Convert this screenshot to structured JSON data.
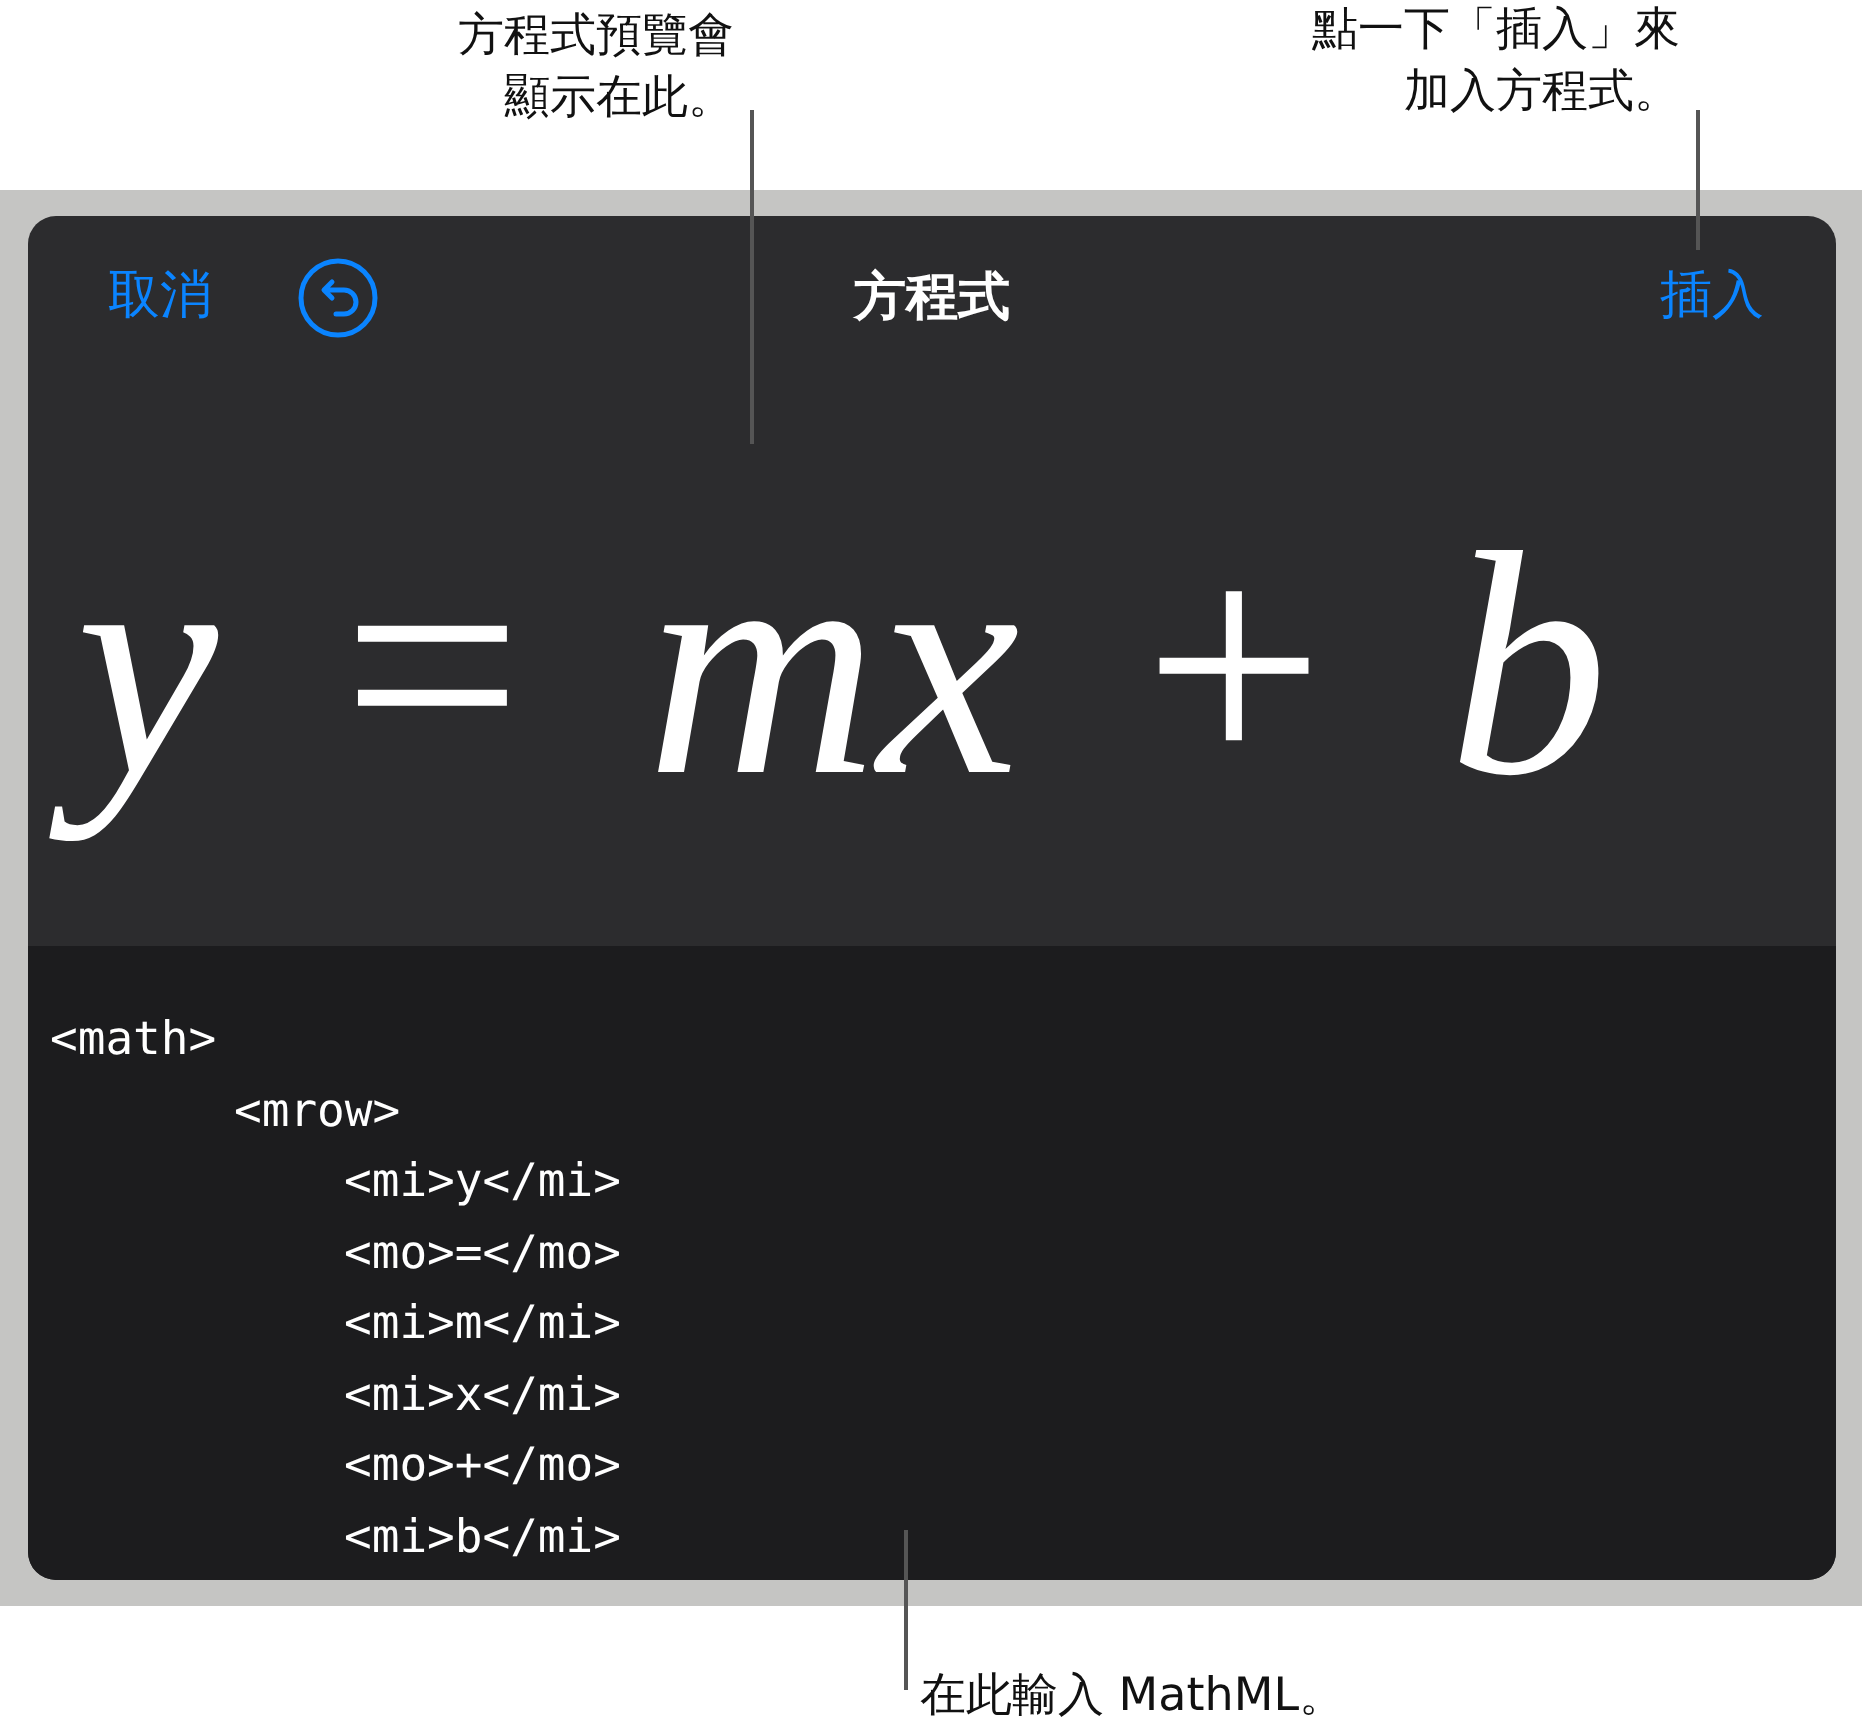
{
  "callouts": [
    {
      "kind": "preview",
      "lines": [
        "方程式預覽會",
        "顯示在此。"
      ]
    },
    {
      "kind": "insert",
      "lines": [
        "點一下「插入」來",
        "加入方程式。"
      ]
    },
    {
      "kind": "editor",
      "lines": [
        "在此輸入 MathML。"
      ]
    }
  ],
  "dialog": {
    "cancel": "取消",
    "title": "方程式",
    "insert": "插入"
  },
  "preview": {
    "equation": "*y* = *mx* + *b*"
  },
  "code": [
    {
      "text": "<math>",
      "children": [
        {
          "text": "<mrow>",
          "children": [
            {
              "text": "<mi>y</mi>"
            },
            {
              "text": "<mo>=</mo>"
            },
            {
              "text": "<mi>m</mi>"
            },
            {
              "text": "<mi>x</mi>"
            },
            {
              "text": "<mo>+</mo>"
            },
            {
              "text": "<mi>b</mi>"
            }
          ]
        }
      ]
    }
  ]
}
